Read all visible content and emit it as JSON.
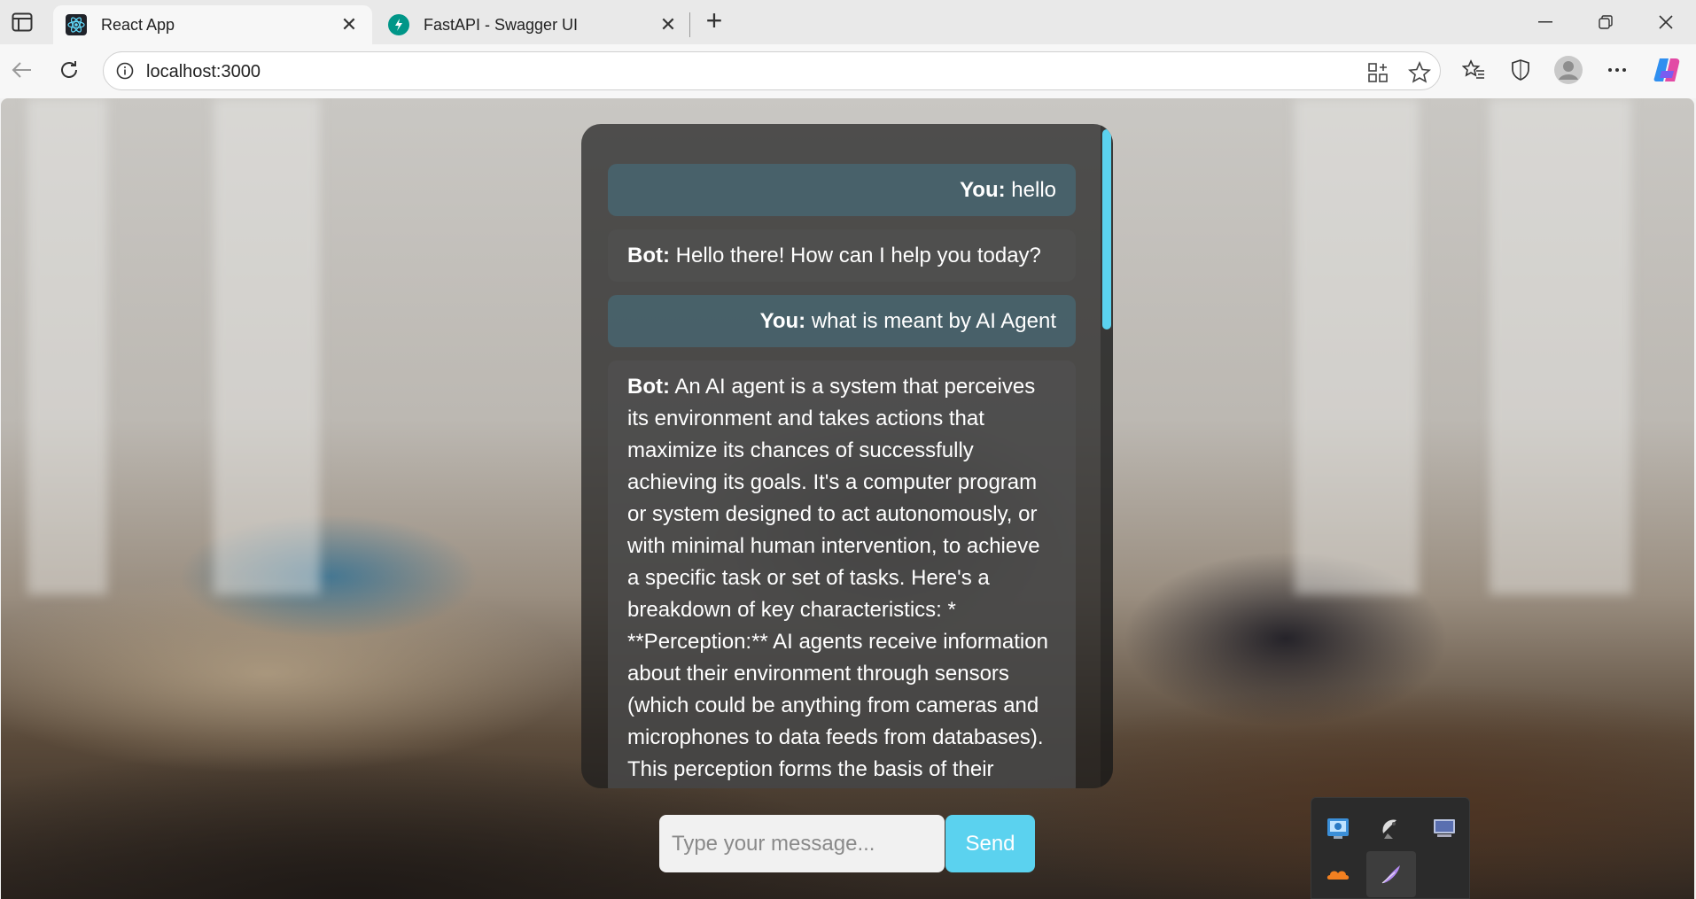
{
  "browser": {
    "tabs": [
      {
        "title": "React App",
        "active": true
      },
      {
        "title": "FastAPI - Swagger UI",
        "active": false
      }
    ],
    "address": "localhost:3000"
  },
  "chat": {
    "messages": [
      {
        "sender": "You:",
        "text": " hello",
        "role": "user"
      },
      {
        "sender": "Bot:",
        "text": " Hello there! How can I help you today?",
        "role": "bot"
      },
      {
        "sender": "You:",
        "text": " what is meant by AI Agent",
        "role": "user"
      },
      {
        "sender": "Bot:",
        "text": " An AI agent is a system that perceives its environment and takes actions that maximize its chances of successfully achieving its goals. It's a computer program or system designed to act autonomously, or with minimal human intervention, to achieve a specific task or set of tasks. Here's a breakdown of key characteristics: * **Perception:** AI agents receive information about their environment through sensors (which could be anything from cameras and microphones to data feeds from databases). This perception forms the basis of their",
        "role": "bot"
      }
    ],
    "input_placeholder": "Type your message...",
    "send_label": "Send"
  },
  "colors": {
    "accent": "#5bd2ef"
  }
}
